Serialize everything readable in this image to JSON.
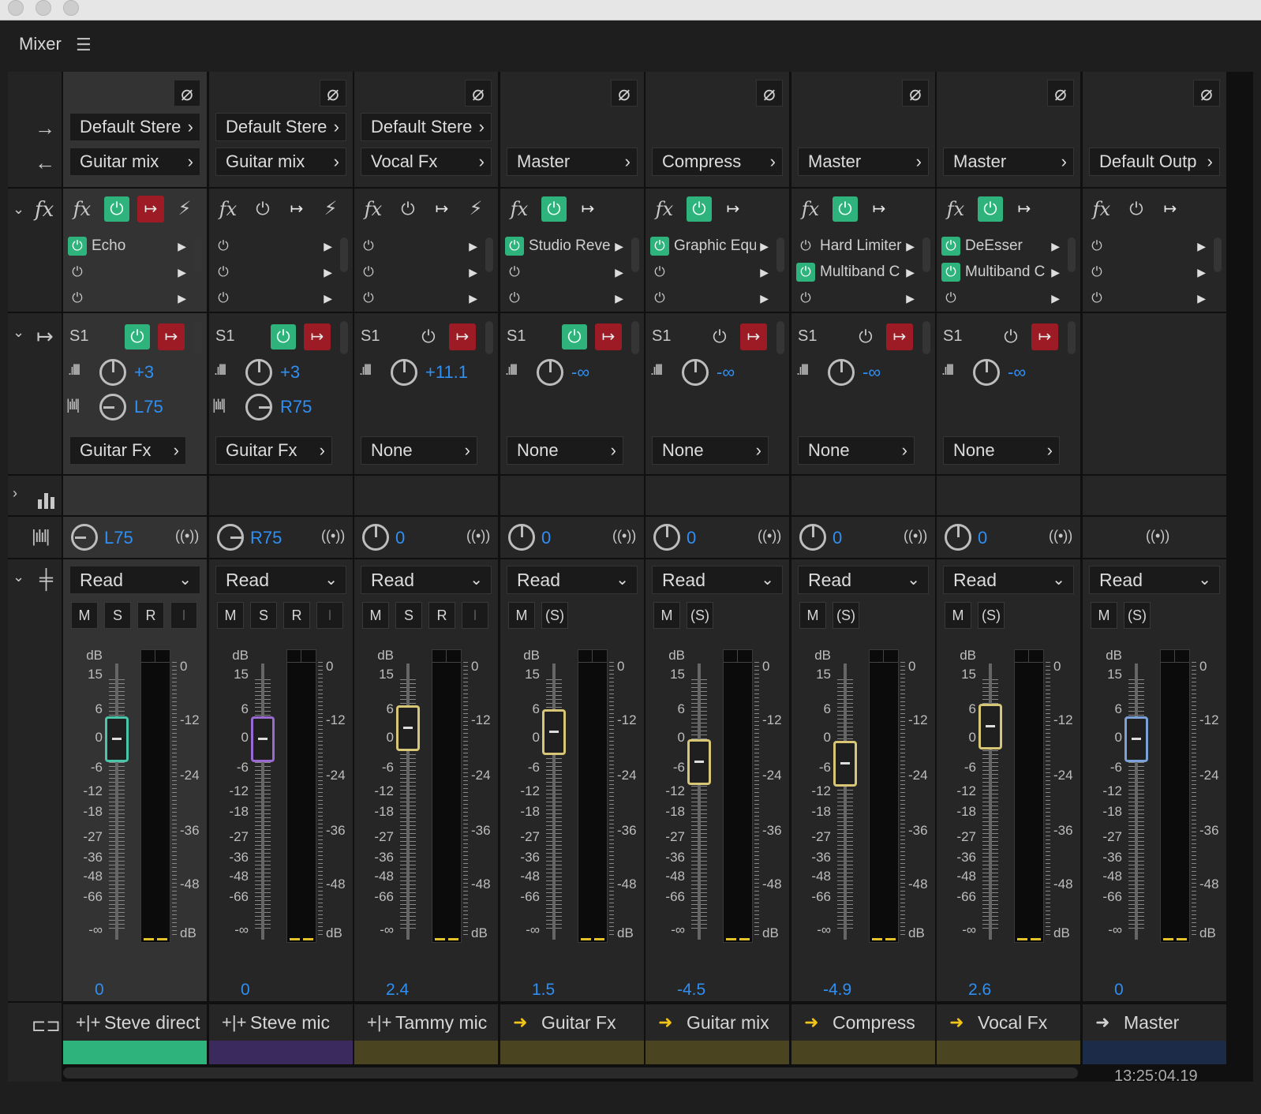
{
  "panel": {
    "title": "Mixer",
    "menu_icon": "hamburger-icon"
  },
  "header_icons": {
    "output_arrow": "→",
    "input_arrow": "←",
    "fx": "fx",
    "sends": "↦",
    "eq": "eq-icon",
    "pan": "pan-icon",
    "volume": "fader-icon",
    "track": "track-icon"
  },
  "tracks": [
    {
      "name": "Steve direct",
      "kind": "audio",
      "color": "#2fb37c",
      "input": "Default Stere",
      "output": "Guitar mix",
      "fx_power": true,
      "fx": [
        {
          "name": "Echo",
          "on": true
        },
        {
          "name": "",
          "on": false
        },
        {
          "name": "",
          "on": false
        }
      ],
      "send": {
        "slot": "S1",
        "power": true,
        "pre": true,
        "level": "+3",
        "pan": "L75",
        "dest": "Guitar Fx"
      },
      "pan": "L75",
      "automation": "Read",
      "msr": [
        "M",
        "S",
        "R",
        "I"
      ],
      "volume": "0",
      "fader_db": 0,
      "fader_color": "#49c5a8",
      "selected": true
    },
    {
      "name": "Steve mic",
      "kind": "audio",
      "color": "#3a2a5e",
      "input": "Default Stere",
      "output": "Guitar mix",
      "fx_power": false,
      "fx": [
        {
          "name": "",
          "on": false
        },
        {
          "name": "",
          "on": false
        },
        {
          "name": "",
          "on": false
        }
      ],
      "send": {
        "slot": "S1",
        "power": true,
        "pre": true,
        "level": "+3",
        "pan": "R75",
        "dest": "Guitar Fx"
      },
      "pan": "R75",
      "automation": "Read",
      "msr": [
        "M",
        "S",
        "R",
        "I"
      ],
      "volume": "0",
      "fader_db": 0,
      "fader_color": "#9a6ad0",
      "selected": false
    },
    {
      "name": "Tammy mic",
      "kind": "audio",
      "color": "#4a4420",
      "input": "Default Stere",
      "output": "Vocal Fx",
      "fx_power": false,
      "fx": [
        {
          "name": "",
          "on": false
        },
        {
          "name": "",
          "on": false
        },
        {
          "name": "",
          "on": false
        }
      ],
      "send": {
        "slot": "S1",
        "power": false,
        "pre": true,
        "level": "+11.1",
        "pan": "",
        "dest": "None"
      },
      "pan": "0",
      "automation": "Read",
      "msr": [
        "M",
        "S",
        "R",
        "I"
      ],
      "volume": "2.4",
      "fader_db": 2.4,
      "fader_color": "#d7c676",
      "selected": false
    },
    {
      "name": "Guitar Fx",
      "kind": "bus",
      "color": "#4a4420",
      "input": "",
      "output": "Master",
      "fx_power": true,
      "fx": [
        {
          "name": "Studio Rever",
          "on": true
        },
        {
          "name": "",
          "on": false
        },
        {
          "name": "",
          "on": false
        }
      ],
      "send": {
        "slot": "S1",
        "power": true,
        "pre": true,
        "level": "-∞",
        "pan": "",
        "dest": "None"
      },
      "pan": "0",
      "automation": "Read",
      "msr": [
        "M",
        "(S)"
      ],
      "volume": "1.5",
      "fader_db": 1.5,
      "fader_color": "#d7c676",
      "selected": false
    },
    {
      "name": "Guitar mix",
      "kind": "bus",
      "color": "#4a4420",
      "input": "",
      "output": "Compress",
      "fx_power": true,
      "fx": [
        {
          "name": "Graphic Equ",
          "on": true
        },
        {
          "name": "",
          "on": false
        },
        {
          "name": "",
          "on": false
        }
      ],
      "send": {
        "slot": "S1",
        "power": false,
        "pre": true,
        "level": "-∞",
        "pan": "",
        "dest": "None"
      },
      "pan": "0",
      "automation": "Read",
      "msr": [
        "M",
        "(S)"
      ],
      "volume": "-4.5",
      "fader_db": -4.5,
      "fader_color": "#d7c676",
      "selected": false
    },
    {
      "name": "Compress",
      "kind": "bus",
      "color": "#4a4420",
      "input": "",
      "output": "Master",
      "fx_power": true,
      "fx": [
        {
          "name": "Hard Limiter",
          "on": false
        },
        {
          "name": "Multiband C",
          "on": true
        },
        {
          "name": "",
          "on": false
        }
      ],
      "send": {
        "slot": "S1",
        "power": false,
        "pre": true,
        "level": "-∞",
        "pan": "",
        "dest": "None"
      },
      "pan": "0",
      "automation": "Read",
      "msr": [
        "M",
        "(S)"
      ],
      "volume": "-4.9",
      "fader_db": -4.9,
      "fader_color": "#d7c676",
      "selected": false
    },
    {
      "name": "Vocal Fx",
      "kind": "bus",
      "color": "#4a4420",
      "input": "",
      "output": "Master",
      "fx_power": true,
      "fx": [
        {
          "name": "DeEsser",
          "on": true
        },
        {
          "name": "Multiband C",
          "on": true
        },
        {
          "name": "",
          "on": false
        }
      ],
      "send": {
        "slot": "S1",
        "power": false,
        "pre": true,
        "level": "-∞",
        "pan": "",
        "dest": "None"
      },
      "pan": "0",
      "automation": "Read",
      "msr": [
        "M",
        "(S)"
      ],
      "volume": "2.6",
      "fader_db": 2.6,
      "fader_color": "#d7c676",
      "selected": false
    },
    {
      "name": "Master",
      "kind": "master",
      "color": "#1c2c48",
      "input": "",
      "output": "Default Outp",
      "fx_power": false,
      "fx": [
        {
          "name": "",
          "on": false
        },
        {
          "name": "",
          "on": false
        },
        {
          "name": "",
          "on": false
        }
      ],
      "send": null,
      "pan": "",
      "automation": "Read",
      "msr": [
        "M",
        "(S)"
      ],
      "volume": "0",
      "fader_db": 0,
      "fader_color": "#7aa2d8",
      "selected": false
    }
  ],
  "fader_scale": [
    "dB",
    "15",
    "6",
    "0",
    "-6",
    "-12",
    "-18",
    "-27",
    "-36",
    "-48",
    "-66",
    "-∞"
  ],
  "meter_scale": [
    "0",
    "-12",
    "-24",
    "-36",
    "-48",
    "dB"
  ],
  "timecode": "13:25:04.19"
}
